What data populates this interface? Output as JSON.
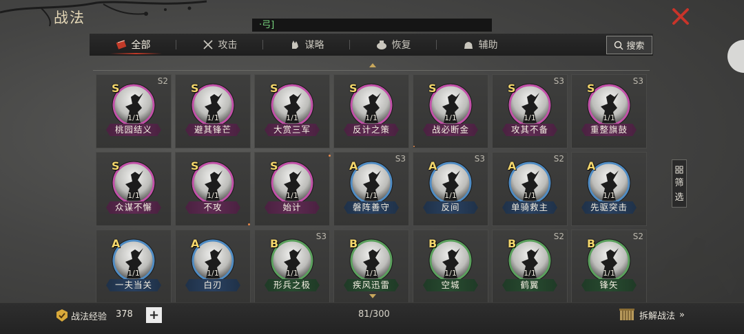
{
  "header": {
    "title": "战法",
    "search_text": "·弓]"
  },
  "tabs": [
    {
      "label": "全部",
      "icon": "scroll-icon",
      "active": true
    },
    {
      "label": "攻击",
      "icon": "crossed-swords-icon",
      "active": false
    },
    {
      "label": "谋略",
      "icon": "hand-icon",
      "active": false
    },
    {
      "label": "恢复",
      "icon": "pot-icon",
      "active": false
    },
    {
      "label": "辅助",
      "icon": "bag-icon",
      "active": false
    }
  ],
  "search_button": {
    "label": "搜索",
    "icon": "magnifier-icon"
  },
  "filter_button": {
    "label_1": "筛",
    "label_2": "选"
  },
  "skills": [
    {
      "grade": "S",
      "name": "桃园结义",
      "count": "1/1",
      "season": "S2"
    },
    {
      "grade": "S",
      "name": "避其锋芒",
      "count": "1/1",
      "season": ""
    },
    {
      "grade": "S",
      "name": "大赏三军",
      "count": "1/1",
      "season": ""
    },
    {
      "grade": "S",
      "name": "反计之策",
      "count": "1/1",
      "season": ""
    },
    {
      "grade": "S",
      "name": "战必断金",
      "count": "1/1",
      "season": ""
    },
    {
      "grade": "S",
      "name": "攻其不备",
      "count": "1/1",
      "season": "S3"
    },
    {
      "grade": "S",
      "name": "重整旗鼓",
      "count": "1/1",
      "season": "S3"
    },
    {
      "grade": "S",
      "name": "众谋不懈",
      "count": "1/1",
      "season": ""
    },
    {
      "grade": "S",
      "name": "不攻",
      "count": "1/1",
      "season": ""
    },
    {
      "grade": "S",
      "name": "始计",
      "count": "1/1",
      "season": ""
    },
    {
      "grade": "A",
      "name": "磐阵善守",
      "count": "1/1",
      "season": "S3"
    },
    {
      "grade": "A",
      "name": "反间",
      "count": "1/1",
      "season": "S3"
    },
    {
      "grade": "A",
      "name": "单骑救主",
      "count": "1/1",
      "season": "S2"
    },
    {
      "grade": "A",
      "name": "先驱突击",
      "count": "1/1",
      "season": ""
    },
    {
      "grade": "A",
      "name": "一夫当关",
      "count": "1/1",
      "season": ""
    },
    {
      "grade": "A",
      "name": "白刃",
      "count": "1/1",
      "season": ""
    },
    {
      "grade": "B",
      "name": "形兵之极",
      "count": "1/1",
      "season": "S3"
    },
    {
      "grade": "B",
      "name": "疾风迅雷",
      "count": "1/1",
      "season": ""
    },
    {
      "grade": "B",
      "name": "空城",
      "count": "1/1",
      "season": ""
    },
    {
      "grade": "B",
      "name": "鹤翼",
      "count": "1/1",
      "season": "S2"
    },
    {
      "grade": "B",
      "name": "锋矢",
      "count": "1/1",
      "season": "S2"
    }
  ],
  "footer": {
    "exp_label": "战法经验",
    "exp_value": "378",
    "plus_label": "+",
    "capacity": "81/300",
    "disassemble_label": "拆解战法",
    "disassemble_arrow": "»"
  },
  "colors": {
    "S": "#c250a8",
    "A": "#4f8cc4",
    "B": "#5aa05c",
    "accent_red": "#c23a28",
    "gold": "#f3d66b"
  }
}
